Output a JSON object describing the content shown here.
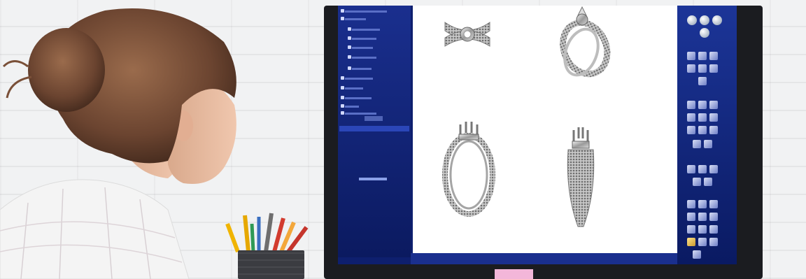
{
  "scene": {
    "description_name": "jewelry-cad-workstation",
    "rings": [
      {
        "id": "ring-top-left"
      },
      {
        "id": "ring-top-right"
      },
      {
        "id": "ring-bottom-left"
      },
      {
        "id": "ring-bottom-right"
      }
    ],
    "colors": {
      "ui_blue": "#0e1f6e",
      "viewport": "#ffffff",
      "monitor_frame": "#1b1c20",
      "wall": "#f1f2f3"
    }
  }
}
